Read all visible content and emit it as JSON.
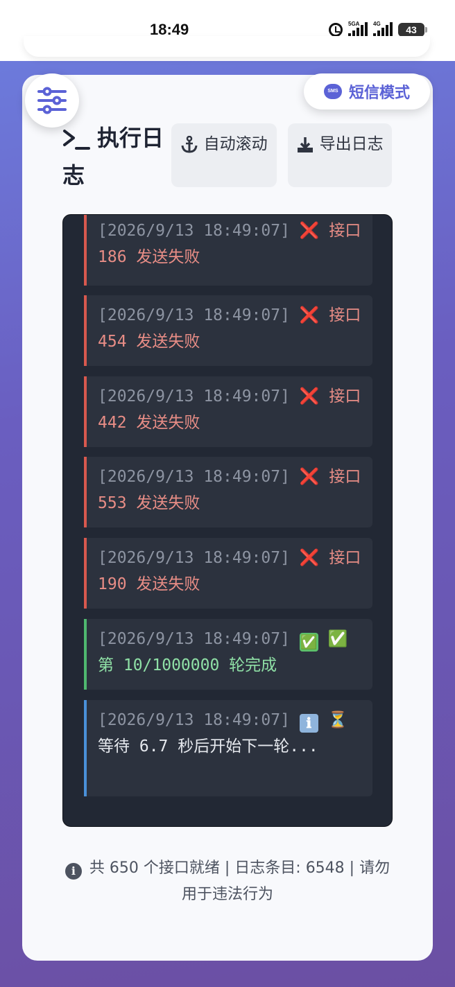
{
  "status_bar": {
    "time": "18:49",
    "signal1_label": "5GA",
    "signal2_label": "4G",
    "battery": "43"
  },
  "sms_mode_button": {
    "icon": "sms-icon",
    "icon_text": "SMS",
    "label": "短信模式"
  },
  "log_header": {
    "title": "执行日志",
    "auto_scroll_label": "自动滚动",
    "export_label": "导出日志"
  },
  "log_entries": [
    {
      "type": "error",
      "timestamp": "[2026/9/13 18:49:07]",
      "status_emoji": "❌",
      "message": "接口 186 发送失败"
    },
    {
      "type": "error",
      "timestamp": "[2026/9/13 18:49:07]",
      "status_emoji": "❌",
      "message": "接口 454 发送失败"
    },
    {
      "type": "error",
      "timestamp": "[2026/9/13 18:49:07]",
      "status_emoji": "❌",
      "message": "接口 442 发送失败"
    },
    {
      "type": "error",
      "timestamp": "[2026/9/13 18:49:07]",
      "status_emoji": "❌",
      "message": "接口 553 发送失败"
    },
    {
      "type": "error",
      "timestamp": "[2026/9/13 18:49:07]",
      "status_emoji": "❌",
      "message": "接口 190 发送失败"
    },
    {
      "type": "success",
      "timestamp": "[2026/9/13 18:49:07]",
      "status_emoji": "✅",
      "message": "✅ 第 10/1000000 轮完成"
    },
    {
      "type": "info",
      "timestamp": "[2026/9/13 18:49:07]",
      "status_emoji": "ℹ",
      "message": "⏳ 等待 6.7 秒后开始下一轮..."
    }
  ],
  "footer": {
    "info_icon": "i",
    "text": "共 650 个接口就绪 | 日志条目: 6548 | 请勿用于违法行为"
  },
  "colors": {
    "accent": "#5b62d6",
    "error": "#d8584e",
    "success": "#4fb86f",
    "info": "#4a90d9",
    "log_bg": "#222834"
  }
}
